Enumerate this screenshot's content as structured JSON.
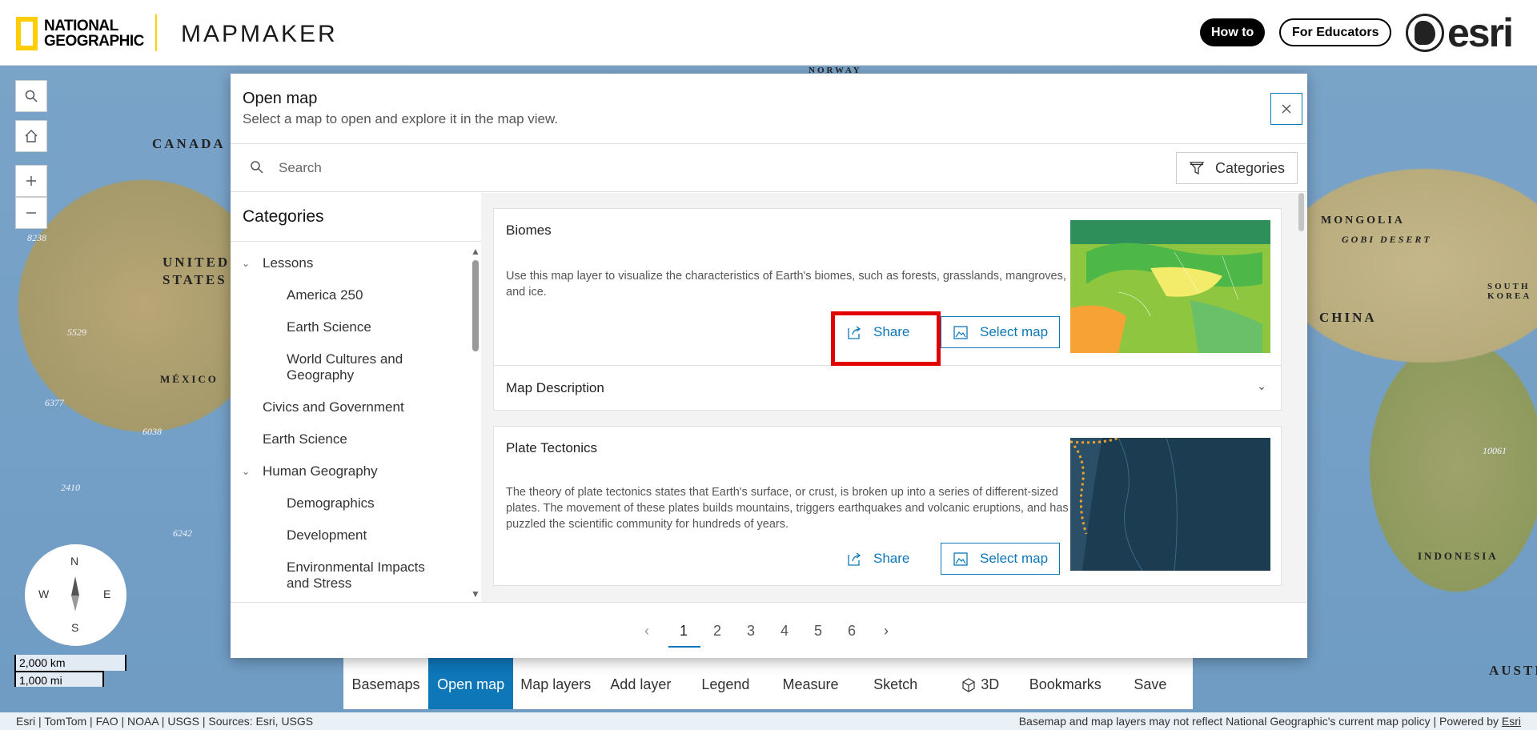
{
  "header": {
    "brand_line1": "NATIONAL",
    "brand_line2": "GEOGRAPHIC",
    "app_name": "MAPMAKER",
    "howto_label": "How to",
    "educators_label": "For Educators",
    "partner_logo": "esri"
  },
  "map": {
    "labels": [
      "CANADA",
      "UNITED",
      "STATES",
      "MÉXICO",
      "MONGOLIA",
      "GOBI DESERT",
      "CHINA",
      "INDONESIA",
      "SOUTH KOREA",
      "NORWAY",
      "AUSTR"
    ],
    "numbers": [
      "8238",
      "5529",
      "6377",
      "6038",
      "2410",
      "6242",
      "10061"
    ],
    "compass": {
      "n": "N",
      "e": "E",
      "s": "S",
      "w": "W"
    },
    "scale_km": "2,000 km",
    "scale_mi": "1,000 mi"
  },
  "toolbar": {
    "items": [
      {
        "label": "Basemaps",
        "icon": "basemaps-icon"
      },
      {
        "label": "Open map",
        "icon": "open-map-icon"
      },
      {
        "label": "Map layers",
        "icon": "layers-icon"
      },
      {
        "label": "Add layer",
        "icon": "add-layer-icon"
      },
      {
        "label": "Legend",
        "icon": "legend-icon"
      },
      {
        "label": "Measure",
        "icon": "measure-icon"
      },
      {
        "label": "Sketch",
        "icon": "sketch-icon"
      },
      {
        "label": "3D",
        "icon": "cube-icon"
      },
      {
        "label": "Bookmarks",
        "icon": "bookmark-icon"
      },
      {
        "label": "Save",
        "icon": "save-icon"
      }
    ]
  },
  "attribution": {
    "left": "Esri | TomTom | FAO | NOAA | USGS | Sources: Esri, USGS",
    "right_text": "Basemap and map layers may not reflect National Geographic's current map policy | Powered by ",
    "right_link": "Esri"
  },
  "modal": {
    "title": "Open map",
    "subtitle": "Select a map to open and explore it in the map view.",
    "search_placeholder": "Search",
    "categories_button": "Categories",
    "categories_heading": "Categories",
    "categories": {
      "lessons": "Lessons",
      "america_250": "America 250",
      "earth_science_sub": "Earth Science",
      "world_cultures_1": "World Cultures and",
      "world_cultures_2": "Geography",
      "civics": "Civics and Government",
      "earth_science": "Earth Science",
      "human_geography": "Human Geography",
      "demographics": "Demographics",
      "development": "Development",
      "env_impacts_1": "Environmental Impacts",
      "env_impacts_2": "and Stress"
    },
    "cards": [
      {
        "title": "Biomes",
        "description": "Use this map layer to visualize the characteristics of Earth's biomes, such as forests, grasslands, mangroves, and ice.",
        "share_label": "Share",
        "select_label": "Select map",
        "details_label": "Map Description"
      },
      {
        "title": "Plate Tectonics",
        "description": "The theory of plate tectonics states that Earth's surface, or crust, is broken up into a series of different-sized plates. The movement of these plates builds mountains, triggers earthquakes and volcanic eruptions, and has puzzled the scientific community for hundreds of years.",
        "share_label": "Share",
        "select_label": "Select map"
      }
    ],
    "pagination": {
      "prev": "‹",
      "next": "›",
      "pages": [
        "1",
        "2",
        "3",
        "4",
        "5",
        "6"
      ],
      "current": "1"
    }
  }
}
